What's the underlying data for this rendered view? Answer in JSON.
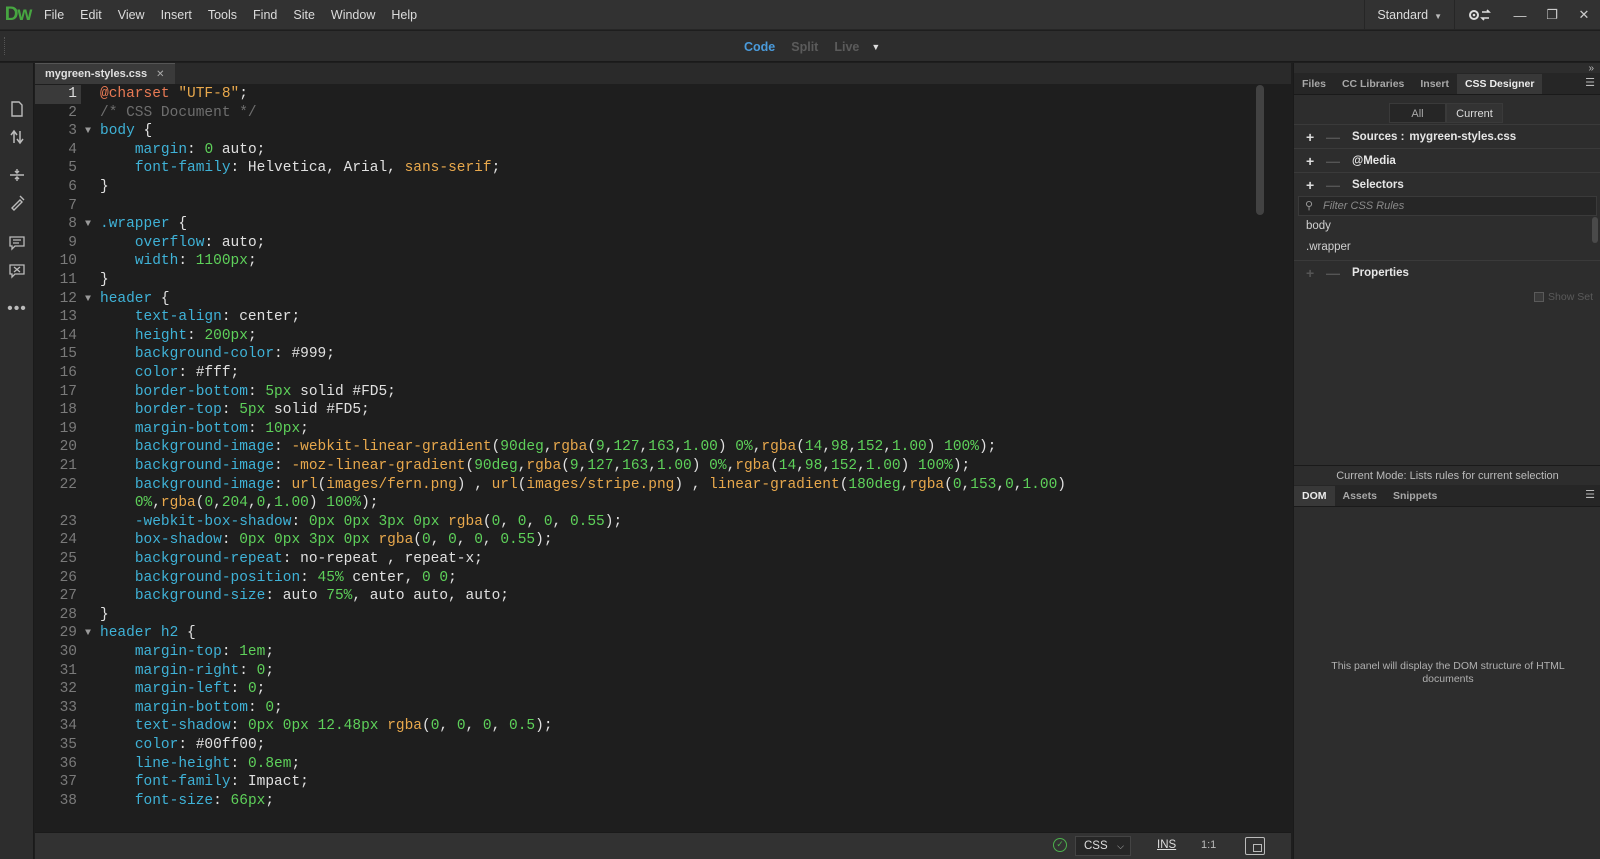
{
  "app": {
    "logo": "Dw",
    "menu": [
      "File",
      "Edit",
      "View",
      "Insert",
      "Tools",
      "Find",
      "Site",
      "Window",
      "Help"
    ],
    "workspace": "Standard"
  },
  "view_switch": {
    "code": "Code",
    "split": "Split",
    "live": "Live"
  },
  "document": {
    "tab_name": "mygreen-styles.css"
  },
  "code_lines": [
    {
      "n": "1",
      "fold": false,
      "html": "<span class='tk-at'>@charset</span> <span class='tk-str'>\"UTF-8\"</span>;"
    },
    {
      "n": "2",
      "fold": false,
      "html": "<span class='tk-cmt'>/* CSS Document */</span>"
    },
    {
      "n": "3",
      "fold": true,
      "html": "<span class='tk-sel'>body</span> {"
    },
    {
      "n": "4",
      "fold": false,
      "html": "    <span class='tk-prop'>margin</span>: <span class='tk-num'>0</span> auto;"
    },
    {
      "n": "5",
      "fold": false,
      "html": "    <span class='tk-prop'>font-family</span>: Helvetica, Arial, <span class='tk-func'>sans-serif</span>;"
    },
    {
      "n": "6",
      "fold": false,
      "html": "}"
    },
    {
      "n": "7",
      "fold": false,
      "html": ""
    },
    {
      "n": "8",
      "fold": true,
      "html": "<span class='tk-sel'>.wrapper</span> {"
    },
    {
      "n": "9",
      "fold": false,
      "html": "    <span class='tk-prop'>overflow</span>: auto;"
    },
    {
      "n": "10",
      "fold": false,
      "html": "    <span class='tk-prop'>width</span>: <span class='tk-num'>1100px</span>;"
    },
    {
      "n": "11",
      "fold": false,
      "html": "}"
    },
    {
      "n": "12",
      "fold": true,
      "html": "<span class='tk-sel'>header</span> {"
    },
    {
      "n": "13",
      "fold": false,
      "html": "    <span class='tk-prop'>text-align</span>: center;"
    },
    {
      "n": "14",
      "fold": false,
      "html": "    <span class='tk-prop'>height</span>: <span class='tk-num'>200px</span>;"
    },
    {
      "n": "15",
      "fold": false,
      "html": "    <span class='tk-prop'>background-color</span>: #999;"
    },
    {
      "n": "16",
      "fold": false,
      "html": "    <span class='tk-prop'>color</span>: #fff;"
    },
    {
      "n": "17",
      "fold": false,
      "html": "    <span class='tk-prop'>border-bottom</span>: <span class='tk-num'>5px</span> solid #FD5;"
    },
    {
      "n": "18",
      "fold": false,
      "html": "    <span class='tk-prop'>border-top</span>: <span class='tk-num'>5px</span> solid #FD5;"
    },
    {
      "n": "19",
      "fold": false,
      "html": "    <span class='tk-prop'>margin-bottom</span>: <span class='tk-num'>10px</span>;"
    },
    {
      "n": "20",
      "fold": false,
      "html": "    <span class='tk-prop'>background-image</span>: <span class='tk-func'>-webkit-linear-gradient</span>(<span class='tk-num'>90deg</span>,<span class='tk-func'>rgba</span>(<span class='tk-num'>9</span>,<span class='tk-num'>127</span>,<span class='tk-num'>163</span>,<span class='tk-num'>1.00</span>) <span class='tk-num'>0%</span>,<span class='tk-func'>rgba</span>(<span class='tk-num'>14</span>,<span class='tk-num'>98</span>,<span class='tk-num'>152</span>,<span class='tk-num'>1.00</span>) <span class='tk-num'>100%</span>);"
    },
    {
      "n": "21",
      "fold": false,
      "html": "    <span class='tk-prop'>background-image</span>: <span class='tk-func'>-moz-linear-gradient</span>(<span class='tk-num'>90deg</span>,<span class='tk-func'>rgba</span>(<span class='tk-num'>9</span>,<span class='tk-num'>127</span>,<span class='tk-num'>163</span>,<span class='tk-num'>1.00</span>) <span class='tk-num'>0%</span>,<span class='tk-func'>rgba</span>(<span class='tk-num'>14</span>,<span class='tk-num'>98</span>,<span class='tk-num'>152</span>,<span class='tk-num'>1.00</span>) <span class='tk-num'>100%</span>);"
    },
    {
      "n": "22",
      "fold": false,
      "html": "    <span class='tk-prop'>background-image</span>: <span class='tk-func'>url</span>(<span class='tk-func'>images/fern.png</span>) , <span class='tk-func'>url</span>(<span class='tk-func'>images/stripe.png</span>) , <span class='tk-func'>linear-gradient</span>(<span class='tk-num'>180deg</span>,<span class='tk-func'>rgba</span>(<span class='tk-num'>0</span>,<span class='tk-num'>153</span>,<span class='tk-num'>0</span>,<span class='tk-num'>1.00</span>)"
    },
    {
      "n": "",
      "fold": false,
      "html": "    <span class='tk-num'>0%</span>,<span class='tk-func'>rgba</span>(<span class='tk-num'>0</span>,<span class='tk-num'>204</span>,<span class='tk-num'>0</span>,<span class='tk-num'>1.00</span>) <span class='tk-num'>100%</span>);"
    },
    {
      "n": "23",
      "fold": false,
      "html": "    <span class='tk-prop'>-webkit-box-shadow</span>: <span class='tk-num'>0px</span> <span class='tk-num'>0px</span> <span class='tk-num'>3px</span> <span class='tk-num'>0px</span> <span class='tk-func'>rgba</span>(<span class='tk-num'>0</span>, <span class='tk-num'>0</span>, <span class='tk-num'>0</span>, <span class='tk-num'>0.55</span>);"
    },
    {
      "n": "24",
      "fold": false,
      "html": "    <span class='tk-prop'>box-shadow</span>: <span class='tk-num'>0px</span> <span class='tk-num'>0px</span> <span class='tk-num'>3px</span> <span class='tk-num'>0px</span> <span class='tk-func'>rgba</span>(<span class='tk-num'>0</span>, <span class='tk-num'>0</span>, <span class='tk-num'>0</span>, <span class='tk-num'>0.55</span>);"
    },
    {
      "n": "25",
      "fold": false,
      "html": "    <span class='tk-prop'>background-repeat</span>: no-repeat , repeat-x;"
    },
    {
      "n": "26",
      "fold": false,
      "html": "    <span class='tk-prop'>background-position</span>: <span class='tk-num'>45%</span> center, <span class='tk-num'>0</span> <span class='tk-num'>0</span>;"
    },
    {
      "n": "27",
      "fold": false,
      "html": "    <span class='tk-prop'>background-size</span>: auto <span class='tk-num'>75%</span>, auto auto, auto;"
    },
    {
      "n": "28",
      "fold": false,
      "html": "}"
    },
    {
      "n": "29",
      "fold": true,
      "html": "<span class='tk-sel'>header h2</span> {"
    },
    {
      "n": "30",
      "fold": false,
      "html": "    <span class='tk-prop'>margin-top</span>: <span class='tk-num'>1em</span>;"
    },
    {
      "n": "31",
      "fold": false,
      "html": "    <span class='tk-prop'>margin-right</span>: <span class='tk-num'>0</span>;"
    },
    {
      "n": "32",
      "fold": false,
      "html": "    <span class='tk-prop'>margin-left</span>: <span class='tk-num'>0</span>;"
    },
    {
      "n": "33",
      "fold": false,
      "html": "    <span class='tk-prop'>margin-bottom</span>: <span class='tk-num'>0</span>;"
    },
    {
      "n": "34",
      "fold": false,
      "html": "    <span class='tk-prop'>text-shadow</span>: <span class='tk-num'>0px</span> <span class='tk-num'>0px</span> <span class='tk-num'>12.48px</span> <span class='tk-func'>rgba</span>(<span class='tk-num'>0</span>, <span class='tk-num'>0</span>, <span class='tk-num'>0</span>, <span class='tk-num'>0.5</span>);"
    },
    {
      "n": "35",
      "fold": false,
      "html": "    <span class='tk-prop'>color</span>: #00ff00;"
    },
    {
      "n": "36",
      "fold": false,
      "html": "    <span class='tk-prop'>line-height</span>: <span class='tk-num'>0.8em</span>;"
    },
    {
      "n": "37",
      "fold": false,
      "html": "    <span class='tk-prop'>font-family</span>: Impact;"
    },
    {
      "n": "38",
      "fold": false,
      "html": "    <span class='tk-prop'>font-size</span>: <span class='tk-num'>66px</span>;"
    }
  ],
  "statusbar": {
    "language": "CSS",
    "mode": "INS",
    "position": "1:1"
  },
  "right_panel": {
    "top_tabs": [
      "Files",
      "CC Libraries",
      "Insert",
      "CSS Designer"
    ],
    "all_label": "All",
    "current_label": "Current",
    "sources_label": "Sources :",
    "sources_file": "mygreen-styles.css",
    "media_label": "@Media",
    "selectors_label": "Selectors",
    "filter_placeholder": "Filter CSS Rules",
    "selectors": [
      "body",
      ".wrapper"
    ],
    "properties_label": "Properties",
    "show_set_label": "Show Set",
    "current_mode": "Current Mode: Lists rules for current selection",
    "bottom_tabs": [
      "DOM",
      "Assets",
      "Snippets"
    ],
    "dom_message": "This panel will display the DOM structure of HTML documents"
  }
}
